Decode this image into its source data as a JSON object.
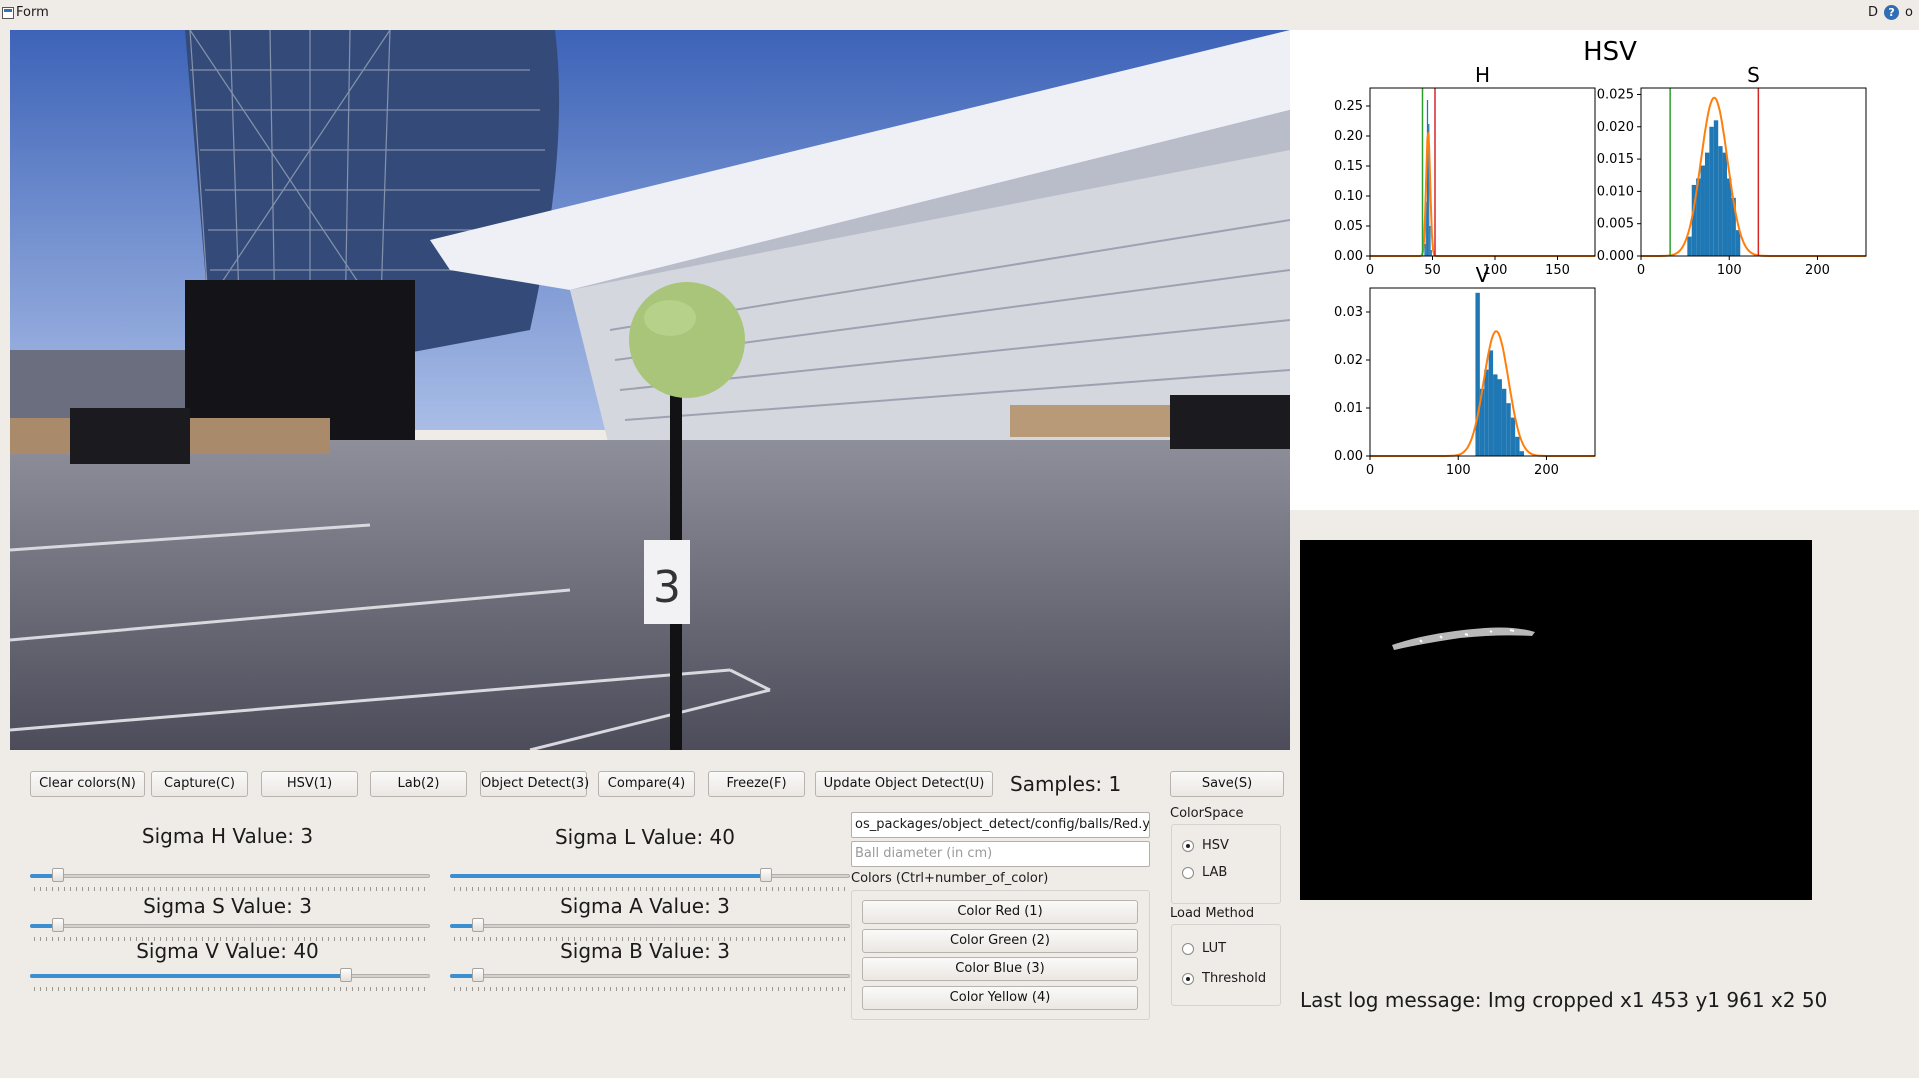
{
  "window": {
    "title": "Form",
    "right_glyph_1": "D",
    "right_glyph_2": "o",
    "help_icon": "help-icon"
  },
  "buttons": {
    "clear": "Clear colors(N)",
    "capture": "Capture(C)",
    "hsv": "HSV(1)",
    "lab": "Lab(2)",
    "object_detect": "Object Detect(3)",
    "compare": "Compare(4)",
    "freeze": "Freeze(F)",
    "update": "Update Object Detect(U)",
    "save": "Save(S)"
  },
  "samples_label": "Samples: 1",
  "sliders": {
    "sigma_h": {
      "label": "Sigma H Value: 3",
      "fraction": 0.07
    },
    "sigma_s": {
      "label": "Sigma S Value: 3",
      "fraction": 0.07
    },
    "sigma_v": {
      "label": "Sigma V Value: 40",
      "fraction": 0.79
    },
    "sigma_l": {
      "label": "Sigma L Value: 40",
      "fraction": 0.79
    },
    "sigma_a": {
      "label": "Sigma A Value: 3",
      "fraction": 0.07
    },
    "sigma_b": {
      "label": "Sigma B Value: 3",
      "fraction": 0.07
    }
  },
  "config_path": {
    "value": "os_packages/object_detect/config/balls/Red.yaml"
  },
  "ball_diameter": {
    "placeholder": "Ball diameter (in cm)"
  },
  "colors_group": {
    "title": "Colors (Ctrl+number_of_color)",
    "items": [
      "Color Red (1)",
      "Color Green (2)",
      "Color Blue (3)",
      "Color Yellow (4)"
    ]
  },
  "colorspace": {
    "title": "ColorSpace",
    "options": [
      "HSV",
      "LAB"
    ],
    "selected": "HSV"
  },
  "load_method": {
    "title": "Load Method",
    "options": [
      "LUT",
      "Threshold"
    ],
    "selected": "Threshold"
  },
  "log_message": "Last log message: Img cropped x1 453 y1 961 x2 50",
  "camera": {
    "pole_number": "3"
  },
  "chart_data": {
    "type": "bar",
    "title": "HSV",
    "subplots": [
      {
        "title": "H",
        "xlim": [
          0,
          180
        ],
        "ylim": [
          0,
          0.28
        ],
        "xticks": [
          "0",
          "50",
          "100",
          "150"
        ],
        "yticks": [
          "0.00",
          "0.05",
          "0.10",
          "0.15",
          "0.20",
          "0.25"
        ],
        "hist_x": [
          44,
          45,
          46,
          47,
          48,
          49
        ],
        "hist_y": [
          0.02,
          0.09,
          0.26,
          0.22,
          0.05,
          0.01
        ],
        "fit": {
          "mean": 46.5,
          "sigma": 1.6,
          "peak": 0.21
        },
        "green_line": 42,
        "red_line": 52
      },
      {
        "title": "S",
        "xlim": [
          0,
          255
        ],
        "ylim": [
          0,
          0.026
        ],
        "xticks": [
          "0",
          "100",
          "200"
        ],
        "yticks": [
          "0.000",
          "0.005",
          "0.010",
          "0.015",
          "0.020",
          "0.025"
        ],
        "hist_x": [
          55,
          60,
          65,
          70,
          75,
          80,
          85,
          90,
          95,
          100,
          105,
          110
        ],
        "hist_y": [
          0.003,
          0.011,
          0.012,
          0.014,
          0.016,
          0.02,
          0.021,
          0.017,
          0.016,
          0.012,
          0.009,
          0.004
        ],
        "fit": {
          "mean": 83,
          "sigma": 15,
          "peak": 0.0245
        },
        "green_line": 33,
        "red_line": 133
      },
      {
        "title": "V",
        "xlim": [
          0,
          255
        ],
        "ylim": [
          0,
          0.035
        ],
        "xticks": [
          "0",
          "100",
          "200"
        ],
        "yticks": [
          "0.00",
          "0.01",
          "0.02",
          "0.03"
        ],
        "hist_x": [
          122,
          127,
          132,
          137,
          142,
          147,
          152,
          157,
          162,
          167,
          172
        ],
        "hist_y": [
          0.034,
          0.014,
          0.018,
          0.022,
          0.017,
          0.016,
          0.014,
          0.011,
          0.008,
          0.004,
          0.001
        ],
        "fit": {
          "mean": 143,
          "sigma": 14,
          "peak": 0.026
        }
      }
    ]
  },
  "colors": {
    "accent": "#3b8fd0",
    "hist_bar": "#1f77b4",
    "fit": "#ff7f0e",
    "low": "#2ca02c",
    "high": "#d62728"
  }
}
